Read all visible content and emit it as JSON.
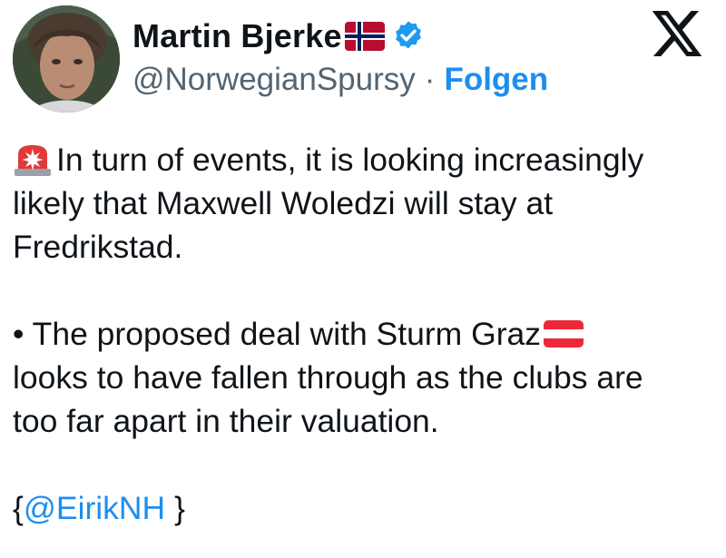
{
  "author": {
    "name": "Martin Bjerke",
    "handle": "@NorwegianSpursy",
    "separator": "·",
    "follow_label": "Folgen"
  },
  "post": {
    "line1": "In turn of events, it is looking increasingly",
    "line2": "likely that Maxwell Woledzi will stay at",
    "line3": "Fredrikstad.",
    "bullet_line1": "• The proposed deal with Sturm Graz",
    "bullet_line2": "looks to have fallen through as the clubs are",
    "bullet_line3": "too far apart in their valuation.",
    "credit_open": "{",
    "credit_mention": "@EirikNH",
    "credit_close": " }"
  },
  "icons": {
    "platform": "x-logo-icon",
    "verified": "verified-badge-icon",
    "siren": "rotating-light-icon",
    "flag_author": "norway-flag-icon",
    "flag_club": "austria-flag-icon"
  },
  "colors": {
    "link": "#1d8ef0",
    "secondary_text": "#536471",
    "verified": "#1d9bf0",
    "text": "#0f1419"
  }
}
